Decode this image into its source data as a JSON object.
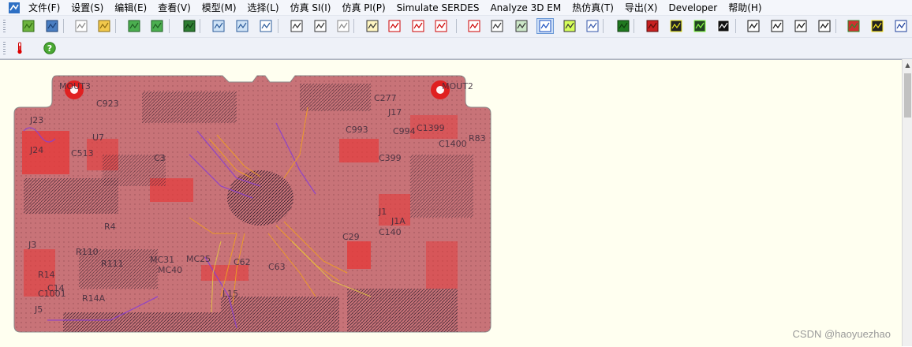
{
  "menu": [
    "文件(F)",
    "设置(S)",
    "编辑(E)",
    "查看(V)",
    "模型(M)",
    "选择(L)",
    "仿真 SI(I)",
    "仿真 PI(P)",
    "Simulate SERDES",
    "Analyze 3D EM",
    "热仿真(T)",
    "导出(X)",
    "Developer",
    "帮助(H)"
  ],
  "toolbar1_icons": [
    "open-project-icon",
    "save-icon",
    "new-file-icon",
    "open-folder-icon",
    "import-board-icon",
    "board-save-icon",
    "layer-stack-icon",
    "zoom-in-icon",
    "zoom-out-icon",
    "zoom-fit-icon",
    "component-select-icon",
    "pin-select-icon",
    "document-icon",
    "netlist-icon",
    "probe-icon",
    "waveform-edit-icon",
    "scope-icon",
    "coil-icon",
    "ibis-model-icon",
    "transmission-line-icon",
    "eye-signal-icon",
    "via-icon",
    "net-route-icon",
    "crosstalk-icon",
    "spectrum-icon",
    "histogram-icon",
    "matrix-icon",
    "report-icon",
    "eye-diagram-icon",
    "rise-time-icon",
    "pdn-icon",
    "s-param-icon",
    "thermal-map-icon",
    "power-bars-icon",
    "emi-brush-icon"
  ],
  "toolbar2_icons": [
    "thermometer-icon",
    "help-icon"
  ],
  "board": {
    "fill_color": "#c87378",
    "refdes": [
      "MOUT3",
      "MOUT2",
      "C923",
      "J17",
      "C277",
      "J23",
      "J24",
      "J1",
      "J3",
      "J5",
      "R83",
      "R14",
      "C14",
      "R4",
      "U7",
      "C513",
      "C3",
      "MC31",
      "MC25",
      "MC40",
      "C29",
      "C399",
      "C993",
      "C994",
      "C1399",
      "C1400",
      "C1001",
      "R110",
      "R111",
      "R14A",
      "C62",
      "C63",
      "L15",
      "J1A",
      "C140"
    ]
  },
  "watermark": "CSDN @haoyuezhao"
}
